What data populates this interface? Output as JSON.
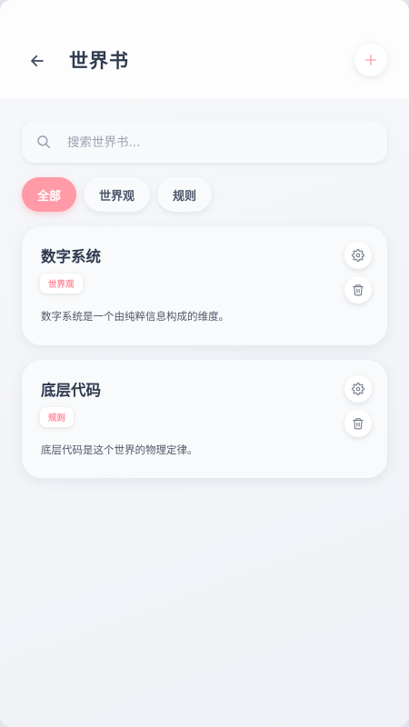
{
  "header": {
    "title": "世界书",
    "back_icon": "arrow-left-icon",
    "add_icon": "plus-icon"
  },
  "search": {
    "placeholder": "搜索世界书...",
    "value": "",
    "icon": "search-icon"
  },
  "filters": [
    {
      "label": "全部",
      "active": true
    },
    {
      "label": "世界观",
      "active": false
    },
    {
      "label": "规则",
      "active": false
    }
  ],
  "entries": [
    {
      "title": "数字系统",
      "tag": "世界观",
      "description": "数字系统是一个由纯粹信息构成的维度。",
      "settings_icon": "gear-icon",
      "delete_icon": "trash-icon"
    },
    {
      "title": "底层代码",
      "tag": "规则",
      "description": "底层代码是这个世界的物理定律。",
      "settings_icon": "gear-icon",
      "delete_icon": "trash-icon"
    }
  ],
  "colors": {
    "accent": "#ff9aa6",
    "accent_text": "#ff8f9d",
    "title_text": "#2f3a4f",
    "muted_text": "#9aa2b0"
  }
}
